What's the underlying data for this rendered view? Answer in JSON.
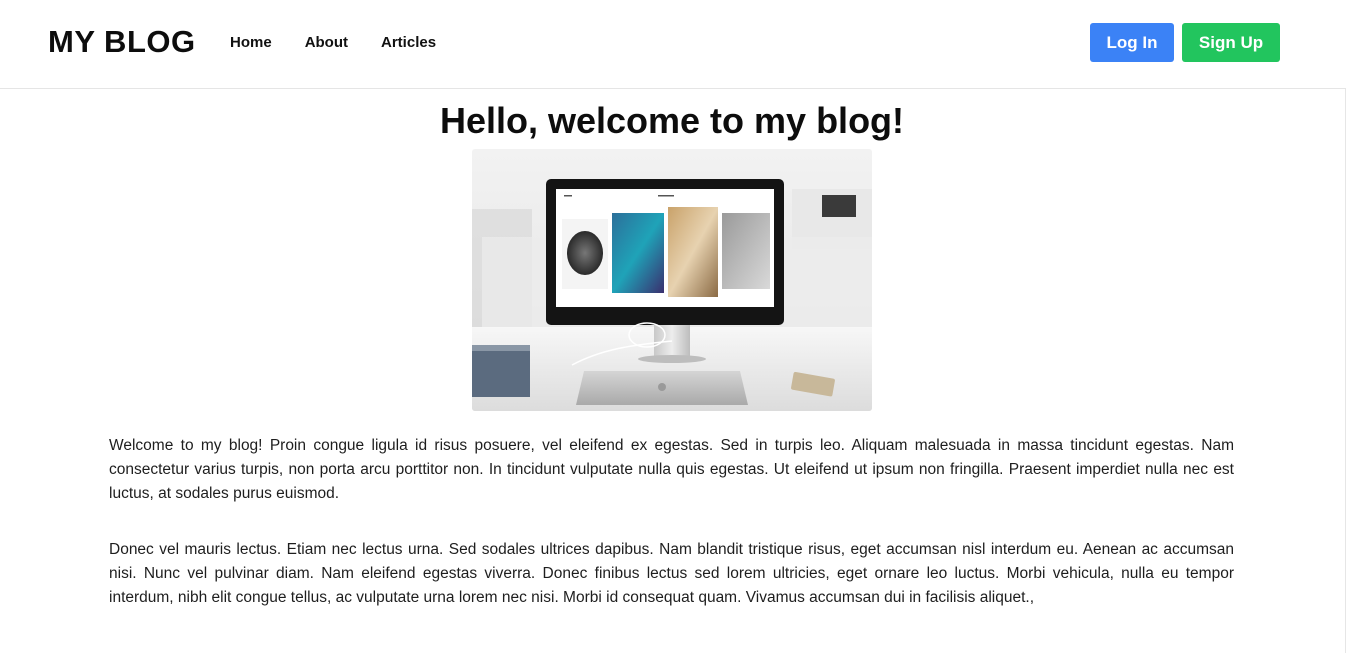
{
  "nav": {
    "brand": "MY BLOG",
    "links": [
      "Home",
      "About",
      "Articles"
    ],
    "login_label": "Log In",
    "signup_label": "Sign Up"
  },
  "hero": {
    "title": "Hello, welcome to my blog!",
    "image_icon": "desk-computer-photo"
  },
  "article": {
    "paragraphs": [
      "Welcome to my blog! Proin congue ligula id risus posuere, vel eleifend ex egestas. Sed in turpis leo. Aliquam malesuada in massa tincidunt egestas. Nam consectetur varius turpis, non porta arcu porttitor non. In tincidunt vulputate nulla quis egestas. Ut eleifend ut ipsum non fringilla. Praesent imperdiet nulla nec est luctus, at sodales purus euismod.",
      "Donec vel mauris lectus. Etiam nec lectus urna. Sed sodales ultrices dapibus. Nam blandit tristique risus, eget accumsan nisl interdum eu. Aenean ac accumsan nisi. Nunc vel pulvinar diam. Nam eleifend egestas viverra. Donec finibus lectus sed lorem ultricies, eget ornare leo luctus. Morbi vehicula, nulla eu tempor interdum, nibh elit congue tellus, ac vulputate urna lorem nec nisi. Morbi id consequat quam. Vivamus accumsan dui in facilisis aliquet.,"
    ]
  },
  "colors": {
    "login": "#3b82f6",
    "signup": "#22c55e",
    "text": "#111111"
  }
}
